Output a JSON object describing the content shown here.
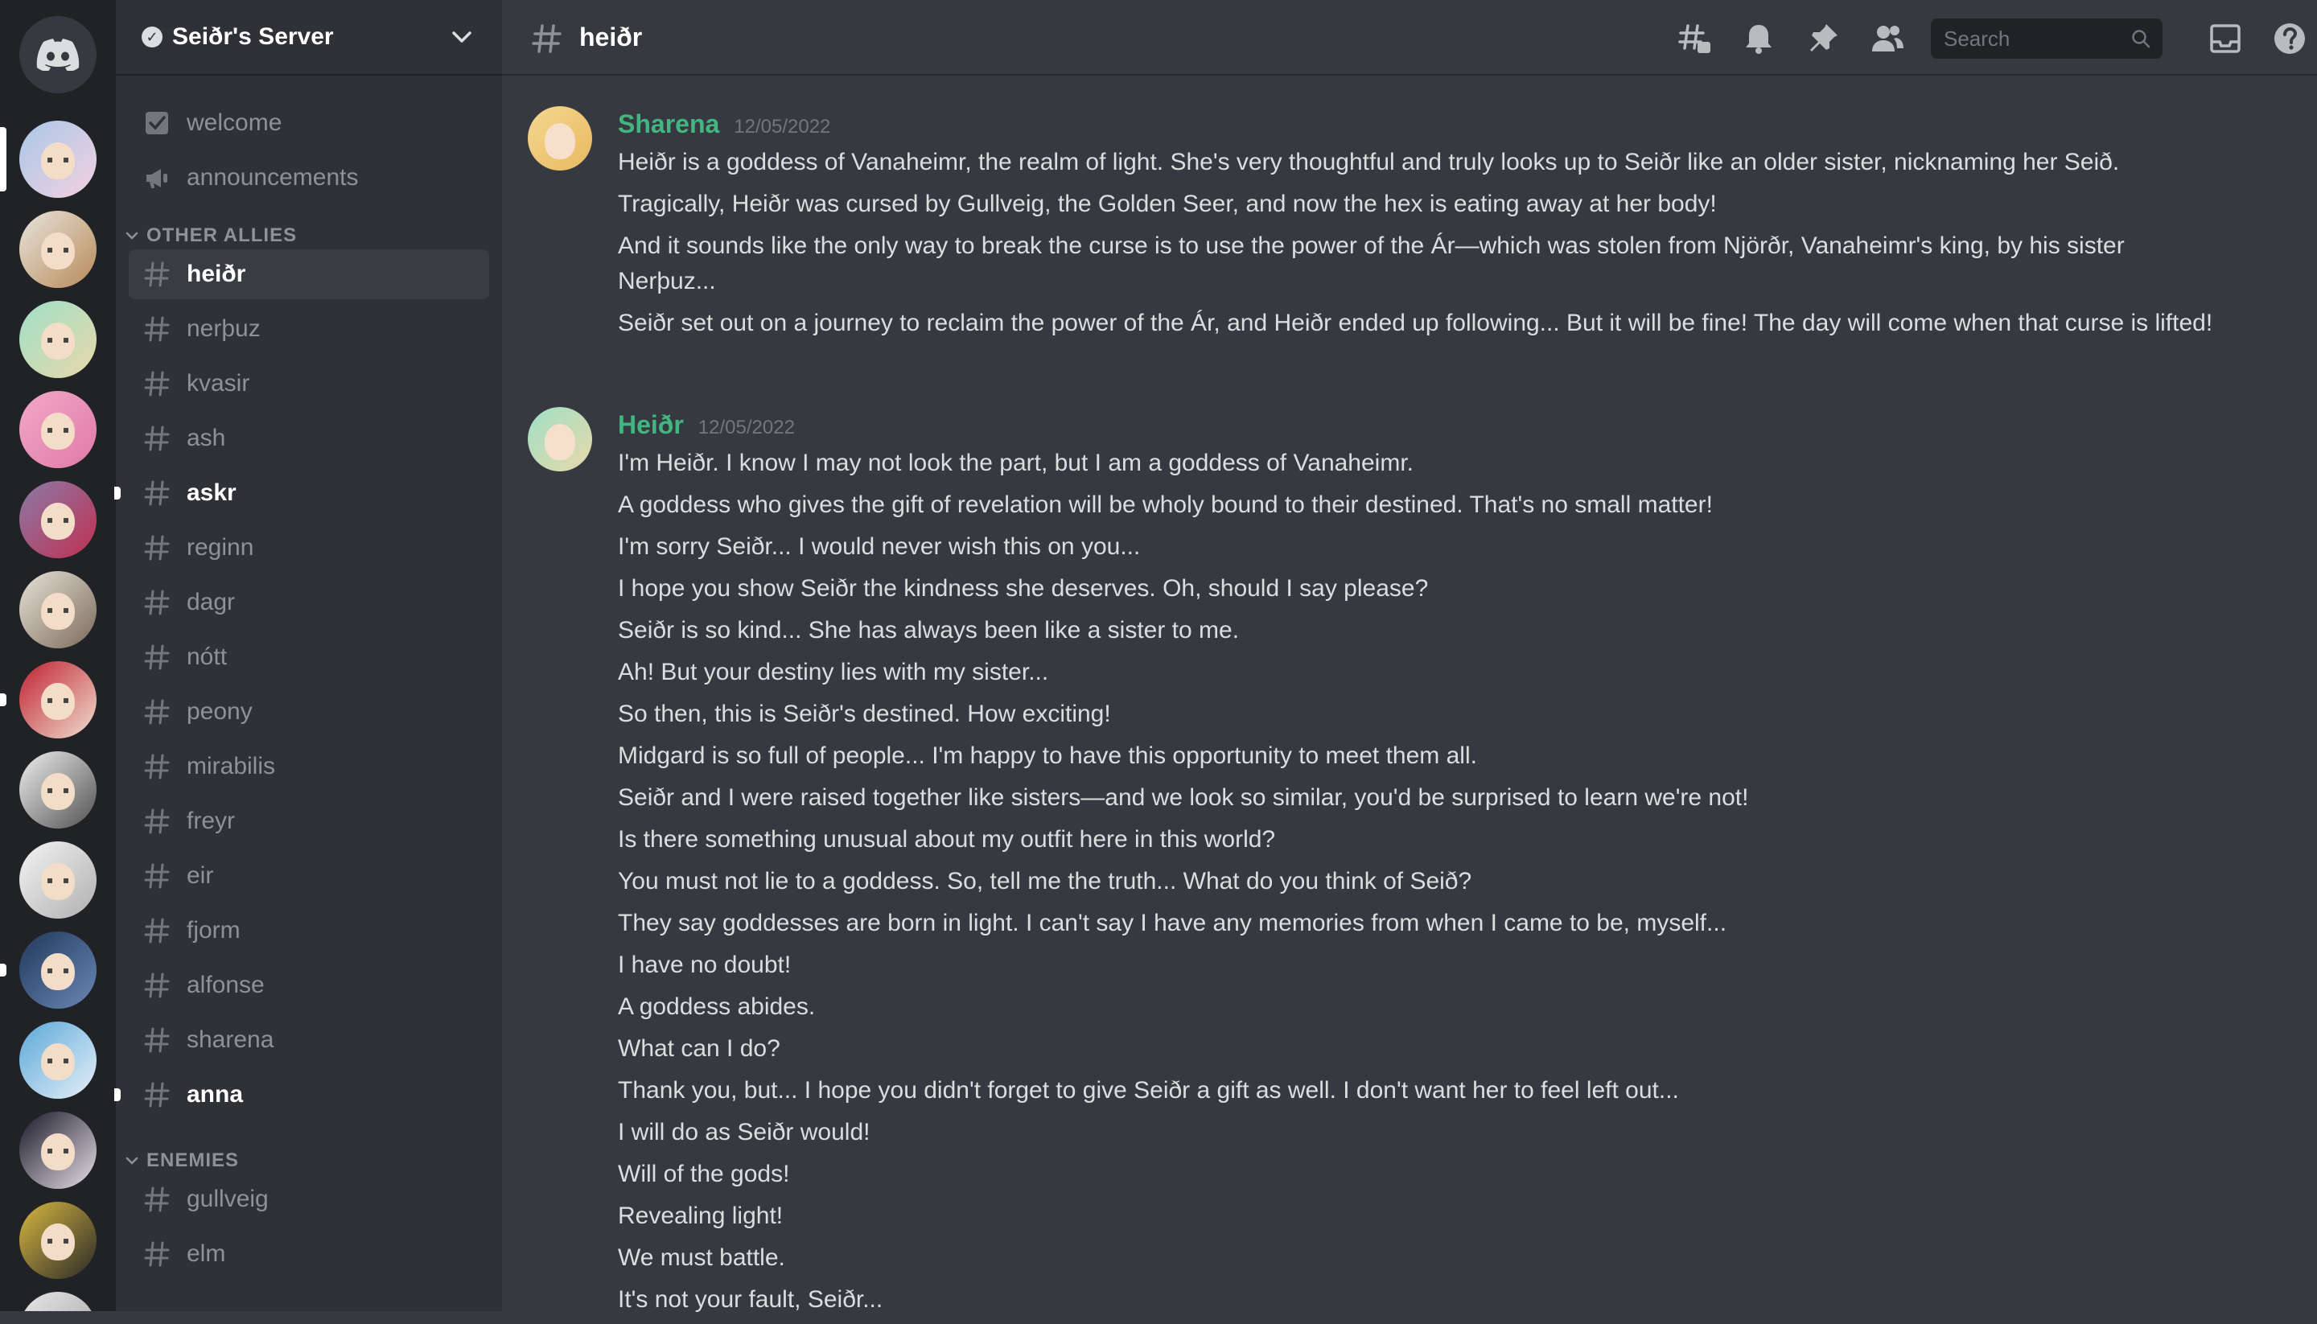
{
  "server": {
    "name": "Seiðr's Server"
  },
  "sidebar": {
    "top_channels": [
      {
        "name": "welcome",
        "icon": "rules-checkbox-icon"
      },
      {
        "name": "announcements",
        "icon": "megaphone-icon"
      }
    ],
    "categories": [
      {
        "name": "OTHER ALLIES",
        "channels": [
          {
            "name": "heiðr",
            "state": "active"
          },
          {
            "name": "nerþuz",
            "state": "normal"
          },
          {
            "name": "kvasir",
            "state": "normal"
          },
          {
            "name": "ash",
            "state": "normal"
          },
          {
            "name": "askr",
            "state": "unread"
          },
          {
            "name": "reginn",
            "state": "normal"
          },
          {
            "name": "dagr",
            "state": "normal"
          },
          {
            "name": "nótt",
            "state": "normal"
          },
          {
            "name": "peony",
            "state": "normal"
          },
          {
            "name": "mirabilis",
            "state": "normal"
          },
          {
            "name": "freyr",
            "state": "normal"
          },
          {
            "name": "eir",
            "state": "normal"
          },
          {
            "name": "fjorm",
            "state": "normal"
          },
          {
            "name": "alfonse",
            "state": "normal"
          },
          {
            "name": "sharena",
            "state": "normal"
          },
          {
            "name": "anna",
            "state": "unread"
          }
        ]
      },
      {
        "name": "ENEMIES",
        "channels": [
          {
            "name": "gullveig",
            "state": "normal"
          },
          {
            "name": "elm",
            "state": "normal"
          }
        ]
      }
    ]
  },
  "header": {
    "channel_name": "heiðr",
    "search_placeholder": "Search",
    "icons": [
      "threads-icon",
      "bell-icon",
      "pin-icon",
      "members-icon",
      "inbox-icon",
      "help-icon"
    ]
  },
  "messages": [
    {
      "author": "Sharena",
      "timestamp": "12/05/2022",
      "lines": [
        "Heiðr is a goddess of Vanaheimr, the realm of light. She's very thoughtful and truly looks up to Seiðr like an older sister, nicknaming her Seið.",
        "Tragically, Heiðr was cursed by Gullveig, the Golden Seer, and now the hex is eating away at her body!",
        "And it sounds like the only way to break the curse is to use the power of the Ár—which was stolen from Njörðr, Vanaheimr's king, by his sister Nerþuz...",
        "Seiðr set out on a journey to reclaim the power of the Ár, and Heiðr ended up following... But it will be fine! The day will come when that curse is lifted!"
      ]
    },
    {
      "author": "Heiðr",
      "timestamp": "12/05/2022",
      "lines": [
        "I'm Heiðr. I know I may not look the part, but I am a goddess of Vanaheimr.",
        "A goddess who gives the gift of revelation will be wholy bound to their destined. That's no small matter!",
        "I'm sorry Seiðr... I would never wish this on you...",
        "I hope you show Seiðr the kindness she deserves. Oh, should I say please?",
        "Seiðr is so kind... She has always been like a sister to me.",
        "Ah! But your destiny lies with my sister...",
        "So then, this is Seiðr's destined. How exciting!",
        "Midgard is so full of people... I'm happy to have this opportunity to meet them all.",
        "Seiðr and I were raised together like sisters—and we look so similar, you'd be surprised to learn we're not!",
        "Is there something unusual about my outfit here in this world?",
        "You must not lie to a goddess. So, tell me the truth... What do you think of Seið?",
        "They say goddesses are born in light. I can't say I have any memories from when I came to be, myself...",
        "I have no doubt!",
        "A goddess abides.",
        "What can I do?",
        "Thank you, but... I hope you didn't forget to give Seiðr a gift as well. I don't want her to feel left out...",
        "I will do as Seiðr would!",
        "Will of the gods!",
        "Revealing light!",
        "We must battle.",
        "It's not your fault, Seiðr..."
      ]
    }
  ],
  "colors": {
    "rail_bg": "#202225",
    "sidebar_bg": "#2f3136",
    "chat_bg": "#36393f",
    "author_green": "#43b581",
    "active_channel_bg": "#393c43"
  }
}
